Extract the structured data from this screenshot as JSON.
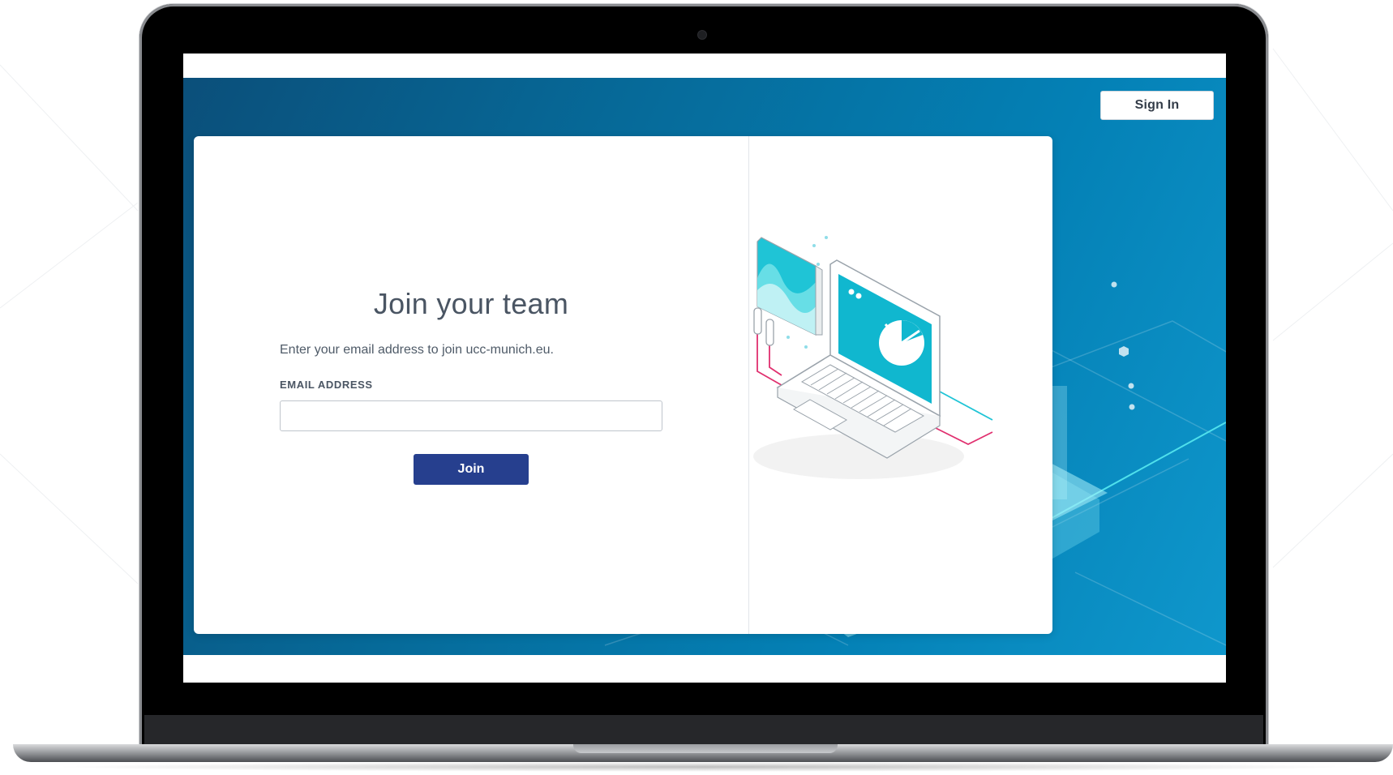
{
  "header": {
    "signin_label": "Sign In"
  },
  "join_form": {
    "title": "Join your team",
    "subtitle": "Enter your email address to join ucc-munich.eu.",
    "email_label": "EMAIL ADDRESS",
    "email_value": "",
    "email_placeholder": "",
    "join_label": "Join"
  },
  "colors": {
    "hero_blue": "#0481b6",
    "join_button": "#263f8e",
    "accent_teal": "#1fc4d6",
    "accent_pink": "#e0306f"
  },
  "icons": [
    "laptop-illustration",
    "camera-icon"
  ]
}
